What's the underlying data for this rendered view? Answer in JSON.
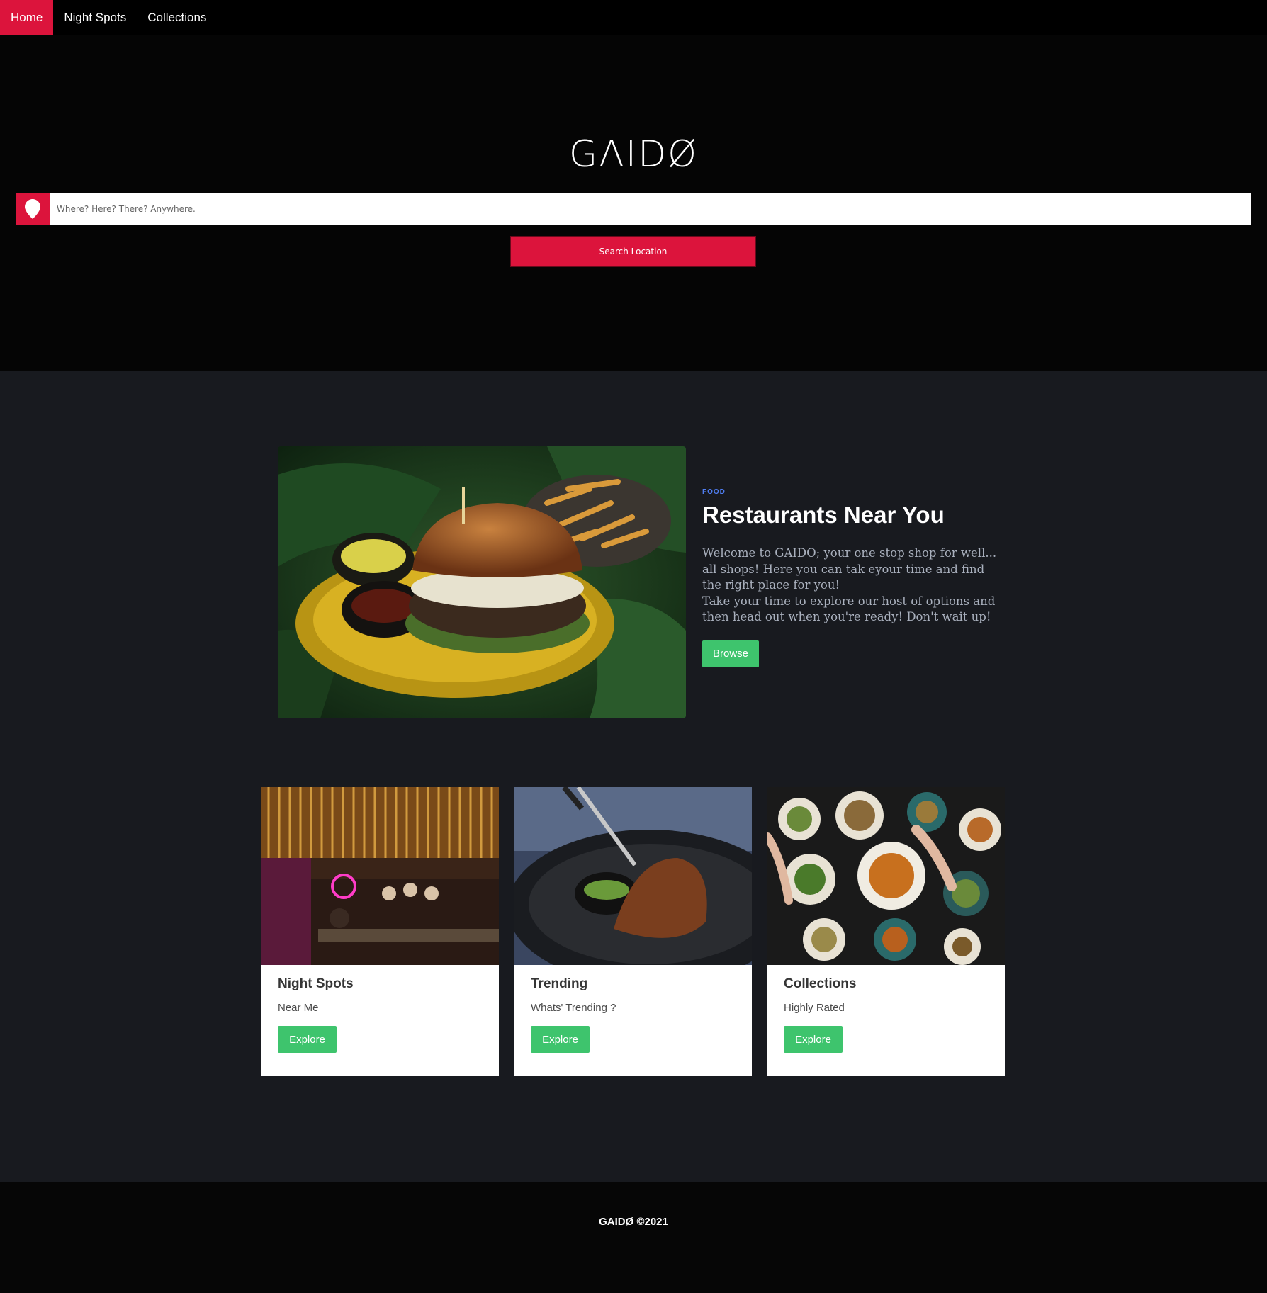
{
  "nav": {
    "items": [
      {
        "label": "Home",
        "active": true
      },
      {
        "label": "Night Spots",
        "active": false
      },
      {
        "label": "Collections",
        "active": false
      }
    ]
  },
  "hero": {
    "logo": "GΛIDØ",
    "search": {
      "placeholder": "Where? Here? There? Anywhere.",
      "value": "",
      "icon": "map-pin-icon"
    },
    "search_button": "Search Location"
  },
  "feature": {
    "eyebrow": "FOOD",
    "title": "Restaurants Near You",
    "body": [
      "Welcome to GAIDO; your one stop shop for well... all shops! Here you can tak eyour time and find the right place for you!",
      "Take your time to explore our host of options and then head out when you're ready! Don't wait up!"
    ],
    "button": "Browse",
    "image": "burger-and-fries-photo"
  },
  "cards": [
    {
      "title": "Night Spots",
      "subtitle": "Near Me",
      "button": "Explore",
      "image": "neon-bar-photo"
    },
    {
      "title": "Trending",
      "subtitle": "Whats' Trending ?",
      "button": "Explore",
      "image": "lamb-shank-dish-photo"
    },
    {
      "title": "Collections",
      "subtitle": "Highly Rated",
      "button": "Explore",
      "image": "dining-table-spread-photo"
    }
  ],
  "footer": {
    "text": "GAIDØ ©2021"
  },
  "colors": {
    "accent": "#dc143c",
    "button_green": "#3ec46d",
    "eyebrow_blue": "#4f7df0",
    "main_bg": "#181a1f"
  }
}
